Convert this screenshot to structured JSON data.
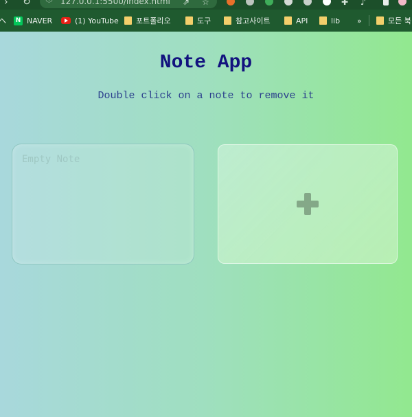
{
  "browser": {
    "url": "127.0.0.1:5500/index.html",
    "bookmarks": [
      {
        "label": "ヘ",
        "icon": "bookmark-edge-glyph"
      },
      {
        "label": "NAVER",
        "icon": "naver-icon"
      },
      {
        "label": "(1) YouTube",
        "icon": "youtube-icon"
      },
      {
        "label": "포트폴리오",
        "icon": "folder-icon"
      },
      {
        "label": "도구",
        "icon": "folder-icon"
      },
      {
        "label": "참고사이트",
        "icon": "folder-icon"
      },
      {
        "label": "API",
        "icon": "folder-icon"
      },
      {
        "label": "lib",
        "icon": "folder-icon"
      },
      {
        "label": "»",
        "icon": "chevron-right-icon"
      },
      {
        "label": "모든 북",
        "icon": "folder-icon"
      }
    ]
  },
  "app": {
    "title": "Note App",
    "subtitle": "Double click on a note to remove it",
    "notes": [
      {
        "placeholder": "Empty Note",
        "value": ""
      }
    ],
    "add_button_symbol": "+"
  }
}
